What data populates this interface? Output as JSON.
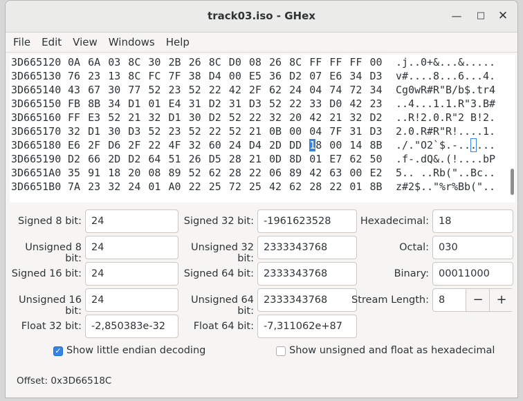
{
  "window": {
    "title": "track03.iso - GHex"
  },
  "menu": [
    "File",
    "Edit",
    "View",
    "Windows",
    "Help"
  ],
  "hex_rows": [
    {
      "offset": "3D665120",
      "bytes": [
        "0A",
        "6A",
        "03",
        "8C",
        "30",
        "2B",
        "26",
        "8C",
        "D0",
        "08",
        "26",
        "8C",
        "FF",
        "FF",
        "FF",
        "00"
      ],
      "ascii": ".j..0+&...&....."
    },
    {
      "offset": "3D665130",
      "bytes": [
        "76",
        "23",
        "13",
        "8C",
        "FC",
        "7F",
        "38",
        "D4",
        "00",
        "E5",
        "36",
        "D2",
        "07",
        "E6",
        "34",
        "D3"
      ],
      "ascii": "v#....8...6...4."
    },
    {
      "offset": "3D665140",
      "bytes": [
        "43",
        "67",
        "30",
        "77",
        "52",
        "23",
        "52",
        "22",
        "42",
        "2F",
        "62",
        "24",
        "04",
        "74",
        "72",
        "34"
      ],
      "ascii": "Cg0wR#R\"B/b$.tr4"
    },
    {
      "offset": "3D665150",
      "bytes": [
        "FB",
        "8B",
        "34",
        "D1",
        "01",
        "E4",
        "31",
        "D2",
        "31",
        "D3",
        "52",
        "22",
        "33",
        "D0",
        "42",
        "23"
      ],
      "ascii": "..4...1.1.R\"3.B#"
    },
    {
      "offset": "3D665160",
      "bytes": [
        "FF",
        "E3",
        "52",
        "21",
        "32",
        "D1",
        "30",
        "D2",
        "52",
        "22",
        "32",
        "20",
        "42",
        "21",
        "32",
        "D2"
      ],
      "ascii": "..R!2.0.R\"2 B!2."
    },
    {
      "offset": "3D665170",
      "bytes": [
        "32",
        "D1",
        "30",
        "D3",
        "52",
        "23",
        "52",
        "22",
        "52",
        "21",
        "0B",
        "00",
        "04",
        "7F",
        "31",
        "D3"
      ],
      "ascii": "2.0.R#R\"R!....1."
    },
    {
      "offset": "3D665180",
      "bytes": [
        "E6",
        "2F",
        "D6",
        "2F",
        "22",
        "4F",
        "32",
        "60",
        "24",
        "D4",
        "2D",
        "DD",
        "18",
        "00",
        "14",
        "8B"
      ],
      "ascii": "./.\"O2`$.-......"
    },
    {
      "offset": "3D665190",
      "bytes": [
        "D2",
        "66",
        "2D",
        "D2",
        "64",
        "51",
        "26",
        "D5",
        "28",
        "21",
        "0D",
        "8D",
        "01",
        "E7",
        "62",
        "50"
      ],
      "ascii": ".f-.dQ&.(!....bP"
    },
    {
      "offset": "3D6651A0",
      "bytes": [
        "35",
        "91",
        "18",
        "20",
        "08",
        "89",
        "52",
        "62",
        "28",
        "22",
        "06",
        "89",
        "42",
        "63",
        "00",
        "E2"
      ],
      "ascii": "5.. ..Rb(\"..Bc.."
    },
    {
      "offset": "3D6651B0",
      "bytes": [
        "7A",
        "23",
        "32",
        "24",
        "01",
        "A0",
        "22",
        "25",
        "72",
        "25",
        "42",
        "62",
        "28",
        "22",
        "01",
        "8B"
      ],
      "ascii": "z#2$..\"%r%Bb(\".."
    }
  ],
  "cursor": {
    "row": 6,
    "col": 12
  },
  "fields": {
    "signed8": {
      "label": "Signed 8 bit:",
      "value": "24"
    },
    "unsigned8": {
      "label": "Unsigned 8 bit:",
      "value": "24"
    },
    "signed16": {
      "label": "Signed 16 bit:",
      "value": "24"
    },
    "unsigned16": {
      "label": "Unsigned 16 bit:",
      "value": "24"
    },
    "float32": {
      "label": "Float 32 bit:",
      "value": "-2,850383e-32"
    },
    "signed32": {
      "label": "Signed 32 bit:",
      "value": "-1961623528"
    },
    "unsigned32": {
      "label": "Unsigned 32 bit:",
      "value": "2333343768"
    },
    "signed64": {
      "label": "Signed 64 bit:",
      "value": "2333343768"
    },
    "unsigned64": {
      "label": "Unsigned 64 bit:",
      "value": "2333343768"
    },
    "float64": {
      "label": "Float 64 bit:",
      "value": "-7,311062e+87"
    },
    "hexadecimal": {
      "label": "Hexadecimal:",
      "value": "18"
    },
    "octal": {
      "label": "Octal:",
      "value": "030"
    },
    "binary": {
      "label": "Binary:",
      "value": "00011000"
    },
    "stream_length": {
      "label": "Stream Length:",
      "value": "8",
      "minus": "−",
      "plus": "+"
    }
  },
  "options": {
    "little_endian": {
      "label": "Show little endian decoding",
      "checked": true
    },
    "unsigned_hex": {
      "label": "Show unsigned and float as hexadecimal",
      "checked": false
    }
  },
  "status": {
    "offset": "Offset: 0x3D66518C"
  },
  "colors": {
    "accent": "#3584e4"
  }
}
